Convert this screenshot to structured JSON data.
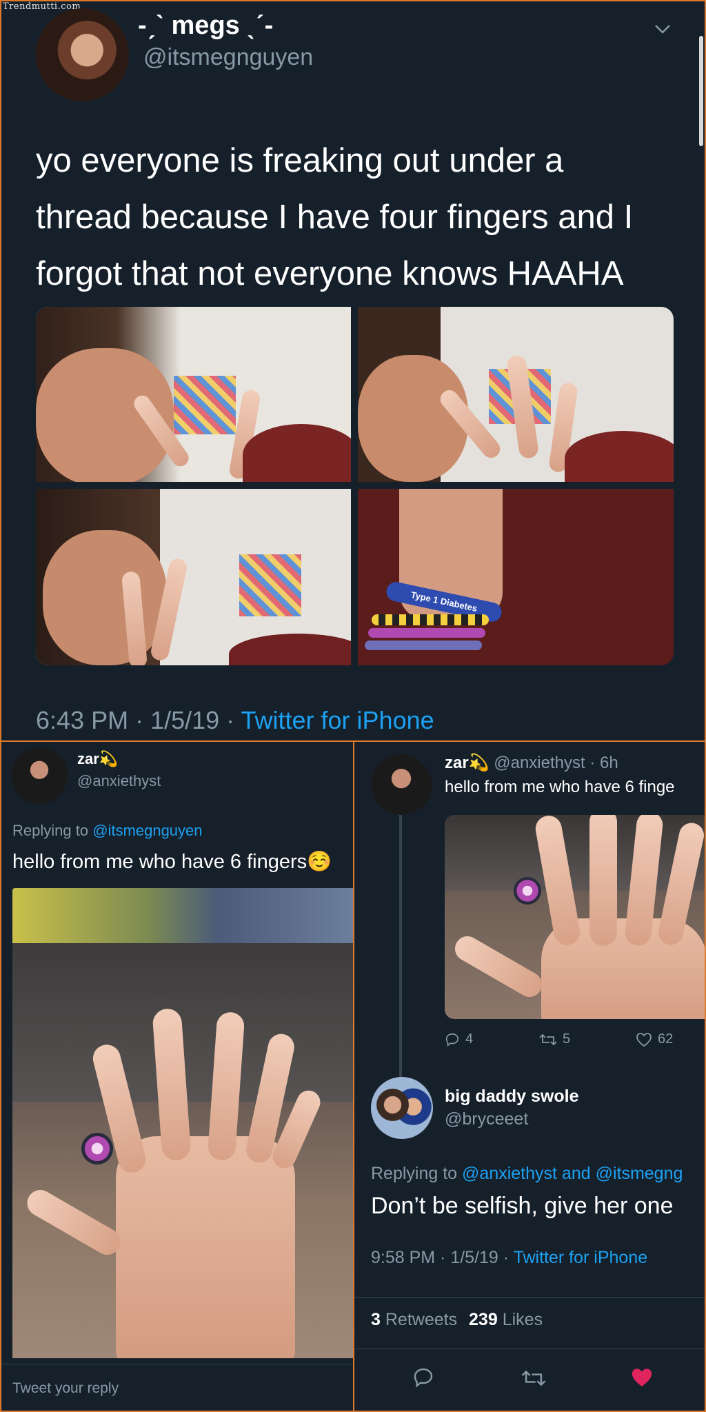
{
  "watermark": "Trendmutti.com",
  "top_tweet": {
    "display_name": "-ˏˋ megs ˎˊ-",
    "handle": "@itsmegnguyen",
    "text_lines": [
      "yo everyone is freaking out under a",
      "thread because I have four fingers and I",
      "forgot that not everyone knows HAAHA"
    ],
    "time": "6:43 PM",
    "date": "1/5/19",
    "source": "Twitter for iPhone",
    "wristband_text": "Type 1 Diabetes"
  },
  "reply_left": {
    "display_name": "zar",
    "name_emoji": "💫",
    "handle": "@anxiethyst",
    "replying_to_prefix": "Replying to",
    "replying_to": "@itsmegnguyen",
    "text": "hello from me who have 6 fingers☺️",
    "reply_placeholder": "Tweet your reply"
  },
  "reply_right": {
    "display_name": "zar",
    "name_emoji": "💫",
    "handle": "@anxiethyst",
    "age": "6h",
    "text": "hello from me who have 6 finge",
    "replies": "4",
    "retweets": "5",
    "likes": "62"
  },
  "reply_bryce": {
    "display_name": "big daddy swole",
    "handle": "@bryceeet",
    "replying_to_prefix": "Replying to",
    "replying_to": "@anxiethyst and @itsmegng",
    "text": "Don’t be selfish, give her one",
    "time": "9:58 PM",
    "date": "1/5/19",
    "source": "Twitter for iPhone",
    "retweets_count": "3",
    "retweets_label": "Retweets",
    "likes_count": "239",
    "likes_label": "Likes",
    "like_color": "#e0245e"
  }
}
